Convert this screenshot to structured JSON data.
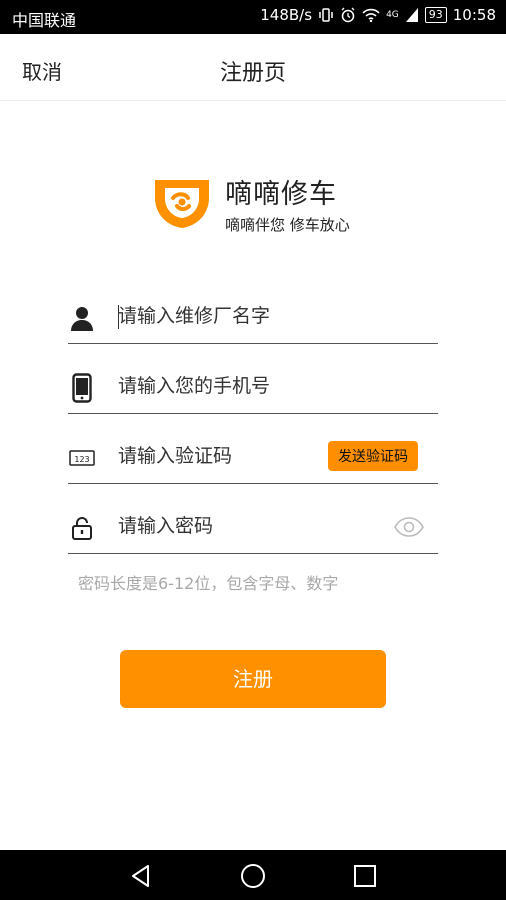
{
  "status_bar": {
    "carrier": "中国联通",
    "net_speed": "148B/s",
    "network": "4G",
    "battery": "93",
    "time": "10:58"
  },
  "header": {
    "cancel_label": "取消",
    "title": "注册页"
  },
  "brand": {
    "name": "嘀嘀修车",
    "slogan": "嘀嘀伴您 修车放心",
    "accent": "#ff9000"
  },
  "form": {
    "shop_name_placeholder": "请输入维修厂名字",
    "phone_placeholder": "请输入您的手机号",
    "code_placeholder": "请输入验证码",
    "send_code_label": "发送验证码",
    "password_placeholder": "请输入密码",
    "password_hint": "密码长度是6-12位，包含字母、数字",
    "submit_label": "注册"
  },
  "icons": {
    "user": "user-icon",
    "phone": "phone-icon",
    "code": "keypad-123-icon",
    "lock": "lock-icon",
    "eye": "eye-icon"
  }
}
